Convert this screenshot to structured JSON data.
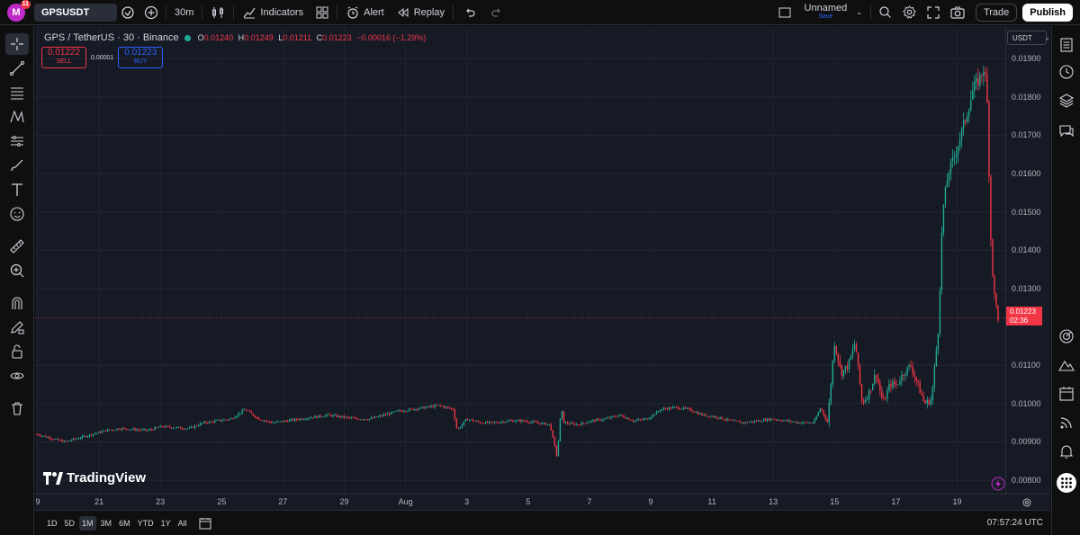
{
  "topbar": {
    "avatar_letter": "M",
    "avatar_badge": "11",
    "symbol": "GPSUSDT",
    "interval": "30m",
    "indicators_label": "Indicators",
    "alert_label": "Alert",
    "replay_label": "Replay",
    "layout_name": "Unnamed",
    "layout_save": "Save",
    "trade_label": "Trade",
    "publish_label": "Publish"
  },
  "legend": {
    "title": "GPS / TetherUS · 30 · Binance",
    "open": "0.01240",
    "high": "0.01249",
    "low": "0.01211",
    "close": "0.01223",
    "change": "−0.00016 (−1.29%)"
  },
  "trade_panel": {
    "sell_price": "0.01222",
    "sell_label": "SELL",
    "spread": "0.00001",
    "buy_price": "0.01223",
    "buy_label": "BUY"
  },
  "currency": "USDT",
  "last_price": {
    "value": "0.01223",
    "countdown": "02:36"
  },
  "watermark": "TradingView",
  "ranges": [
    "1D",
    "5D",
    "1M",
    "3M",
    "6M",
    "YTD",
    "1Y",
    "All"
  ],
  "active_range": "1M",
  "clock": "07:57:24 UTC",
  "colors": {
    "up": "#22ab94",
    "down": "#f23645",
    "bg": "#161a25",
    "accent": "#2962ff"
  },
  "chart_data": {
    "type": "candlestick",
    "y_ticks": [
      "0.01900",
      "0.01800",
      "0.01700",
      "0.01600",
      "0.01500",
      "0.01400",
      "0.01300",
      "0.01100",
      "0.01000",
      "0.00900",
      "0.00800"
    ],
    "x_ticks": [
      "9",
      "21",
      "23",
      "25",
      "27",
      "29",
      "Aug",
      "3",
      "5",
      "7",
      "9",
      "11",
      "13",
      "15",
      "17",
      "19"
    ],
    "ylim": [
      0.00765,
      0.01985
    ],
    "price_series": [
      [
        0,
        0.0092
      ],
      [
        2,
        0.009
      ],
      [
        3,
        0.0091
      ],
      [
        5,
        0.0093
      ],
      [
        6,
        0.00935
      ],
      [
        8,
        0.0093
      ],
      [
        9,
        0.0094
      ],
      [
        11,
        0.00935
      ],
      [
        12,
        0.0095
      ],
      [
        14,
        0.0096
      ],
      [
        15,
        0.00985
      ],
      [
        16,
        0.0096
      ],
      [
        17,
        0.0095
      ],
      [
        19,
        0.0096
      ],
      [
        20,
        0.00965
      ],
      [
        21,
        0.0097
      ],
      [
        22,
        0.00965
      ],
      [
        23,
        0.0096
      ],
      [
        24,
        0.0096
      ],
      [
        25,
        0.0097
      ],
      [
        26,
        0.0098
      ],
      [
        27,
        0.00985
      ],
      [
        28,
        0.0099
      ],
      [
        29,
        0.00995
      ],
      [
        30,
        0.00985
      ],
      [
        30.3,
        0.0093
      ],
      [
        31,
        0.0096
      ],
      [
        32,
        0.0095
      ],
      [
        33,
        0.0095
      ],
      [
        34,
        0.00955
      ],
      [
        35,
        0.00955
      ],
      [
        36,
        0.0095
      ],
      [
        37,
        0.00945
      ],
      [
        37.5,
        0.0086
      ],
      [
        37.8,
        0.0099
      ],
      [
        38,
        0.0095
      ],
      [
        39,
        0.00945
      ],
      [
        40,
        0.00955
      ],
      [
        41,
        0.0096
      ],
      [
        42,
        0.0097
      ],
      [
        43,
        0.00955
      ],
      [
        44,
        0.0096
      ],
      [
        45,
        0.00985
      ],
      [
        46,
        0.0099
      ],
      [
        47,
        0.00985
      ],
      [
        48,
        0.0097
      ],
      [
        49,
        0.00965
      ],
      [
        50,
        0.00955
      ],
      [
        51,
        0.0095
      ],
      [
        52,
        0.00955
      ],
      [
        53,
        0.0096
      ],
      [
        54,
        0.00955
      ],
      [
        55,
        0.0095
      ],
      [
        56,
        0.0095
      ],
      [
        56.5,
        0.0099
      ],
      [
        57,
        0.0095
      ],
      [
        57.5,
        0.0116
      ],
      [
        58,
        0.0108
      ],
      [
        58.5,
        0.011
      ],
      [
        59,
        0.0116
      ],
      [
        59.5,
        0.01
      ],
      [
        60,
        0.0103
      ],
      [
        60.5,
        0.0108
      ],
      [
        61,
        0.01
      ],
      [
        61.5,
        0.0105
      ],
      [
        62,
        0.0105
      ],
      [
        62.5,
        0.0108
      ],
      [
        63,
        0.011
      ],
      [
        63.5,
        0.0105
      ],
      [
        64,
        0.01
      ],
      [
        64.5,
        0.0101
      ],
      [
        65,
        0.012
      ],
      [
        65.3,
        0.015
      ],
      [
        65.7,
        0.016
      ],
      [
        66.2,
        0.0165
      ],
      [
        66.6,
        0.017
      ],
      [
        67,
        0.0175
      ],
      [
        67.5,
        0.0182
      ],
      [
        68,
        0.0185
      ],
      [
        68.3,
        0.0188
      ],
      [
        68.5,
        0.018
      ],
      [
        68.8,
        0.014
      ],
      [
        69,
        0.0129
      ],
      [
        69.3,
        0.01223
      ]
    ]
  }
}
